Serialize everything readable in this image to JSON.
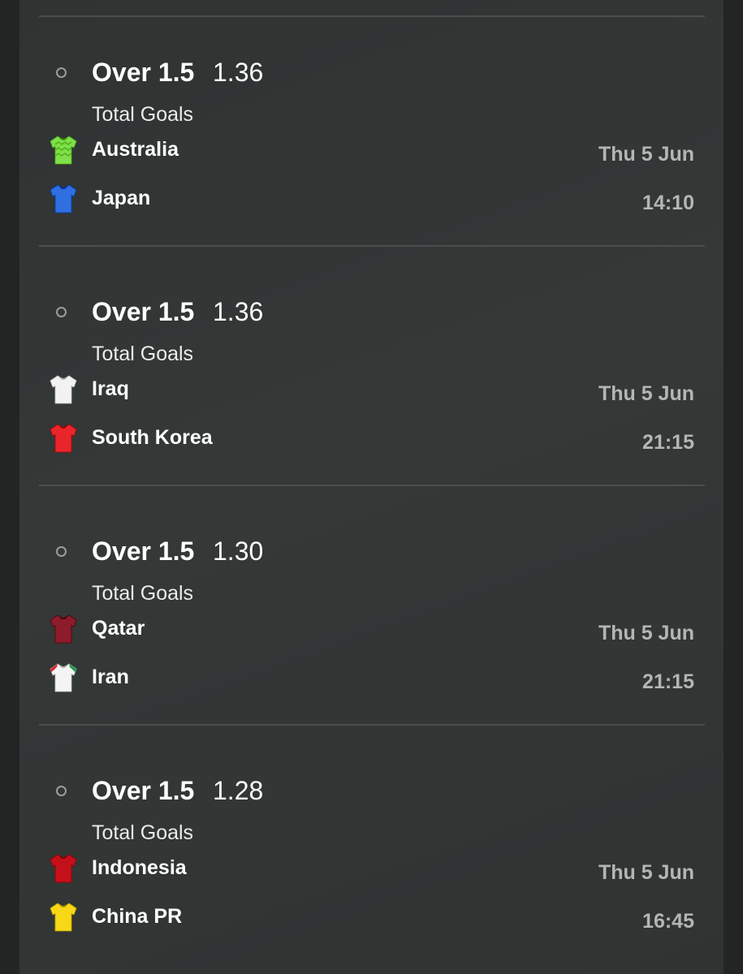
{
  "bets": [
    {
      "selection": "Over 1.5",
      "odds": "1.36",
      "market": "Total Goals",
      "home": {
        "name": "Australia",
        "kit_color": "#7fe04a",
        "kit_pattern": "zigzag",
        "kit_icon": "jersey-green-icon"
      },
      "away": {
        "name": "Japan",
        "kit_color": "#2f6fe0",
        "kit_pattern": "plain",
        "kit_icon": "jersey-blue-icon"
      },
      "date": "Thu 5 Jun",
      "time": "14:10"
    },
    {
      "selection": "Over 1.5",
      "odds": "1.36",
      "market": "Total Goals",
      "home": {
        "name": "Iraq",
        "kit_color": "#f2f2f2",
        "kit_pattern": "plain",
        "kit_icon": "jersey-white-icon"
      },
      "away": {
        "name": "South Korea",
        "kit_color": "#e8262b",
        "kit_pattern": "plain",
        "kit_icon": "jersey-red-icon"
      },
      "date": "Thu 5 Jun",
      "time": "21:15"
    },
    {
      "selection": "Over 1.5",
      "odds": "1.30",
      "market": "Total Goals",
      "home": {
        "name": "Qatar",
        "kit_color": "#8c1c2c",
        "kit_pattern": "plain",
        "kit_icon": "jersey-maroon-icon"
      },
      "away": {
        "name": "Iran",
        "kit_color": "#f4f4f4",
        "kit_pattern": "trim",
        "kit_icon": "jersey-white-icon"
      },
      "date": "Thu 5 Jun",
      "time": "21:15"
    },
    {
      "selection": "Over 1.5",
      "odds": "1.28",
      "market": "Total Goals",
      "home": {
        "name": "Indonesia",
        "kit_color": "#c4101a",
        "kit_pattern": "plain",
        "kit_icon": "jersey-red-icon"
      },
      "away": {
        "name": "China PR",
        "kit_color": "#f7d716",
        "kit_pattern": "plain",
        "kit_icon": "jersey-yellow-icon"
      },
      "date": "Thu 5 Jun",
      "time": "16:45"
    }
  ]
}
